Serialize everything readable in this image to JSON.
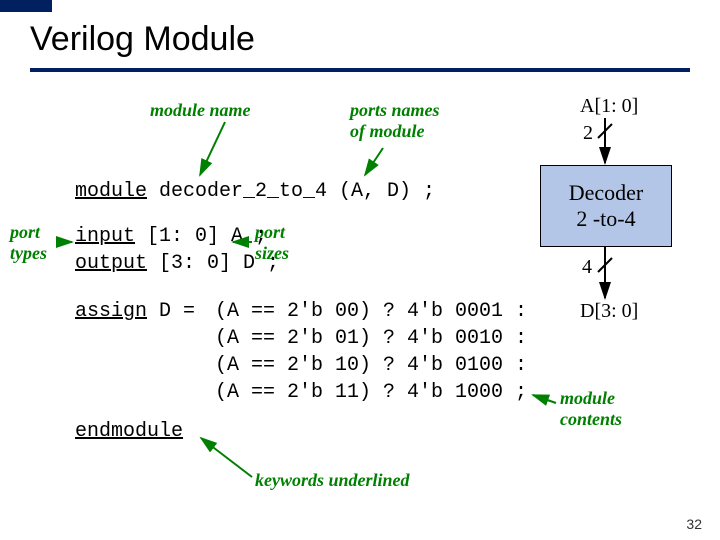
{
  "title": "Verilog Module",
  "annotations": {
    "module_name": "module name",
    "ports_names": "ports names\nof module",
    "port_types": "port\ntypes",
    "port_sizes": "port\nsizes",
    "module_contents": "module\ncontents",
    "keywords_underlined": "keywords underlined"
  },
  "code": {
    "decl_kw": "module",
    "decl_rest": " decoder_2_to_4 (A, D) ;",
    "input_kw": "input",
    "input_rest": " [1: 0] A ;",
    "output_kw": "output",
    "output_rest": " [3: 0] D ;",
    "assign_kw": "assign",
    "assign_rest": " D =",
    "cond1": "(A == 2'b 00) ? 4'b 0001 :",
    "cond2": "(A == 2'b 01) ? 4'b 0010 :",
    "cond3": "(A == 2'b 10) ? 4'b 0100 :",
    "cond4": "(A == 2'b 11) ? 4'b 1000 ;",
    "end_kw": "endmodule"
  },
  "diagram": {
    "top_signal": "A[1: 0]",
    "top_width": "2",
    "box": "Decoder\n2 -to-4",
    "bot_width": "4",
    "bot_signal": "D[3: 0]"
  },
  "slide_number": "32"
}
